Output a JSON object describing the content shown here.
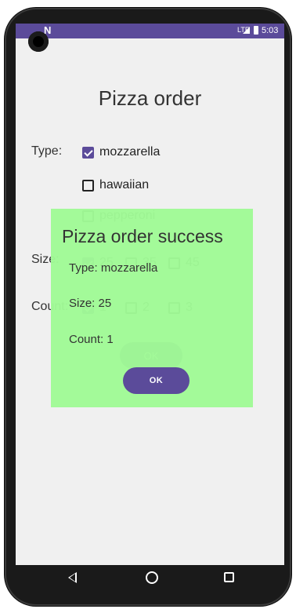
{
  "statusbar": {
    "time": "5:03",
    "network": "LTE"
  },
  "app": {
    "title": "Pizza order"
  },
  "form": {
    "type_label": "Type:",
    "type_options": [
      {
        "label": "mozzarella",
        "checked": true
      },
      {
        "label": "hawaiian",
        "checked": false
      },
      {
        "label": "pepperoni",
        "checked": false
      }
    ],
    "size_label": "Size:",
    "size_options": [
      {
        "label": "25",
        "checked": true
      },
      {
        "label": "35",
        "checked": false
      },
      {
        "label": "45",
        "checked": false
      }
    ],
    "count_label": "Count:",
    "count_options": [
      {
        "label": "1",
        "checked": true
      },
      {
        "label": "2",
        "checked": false
      },
      {
        "label": "3",
        "checked": false
      }
    ],
    "ok_label": "OK"
  },
  "dialog": {
    "title": "Pizza order success",
    "type_line": "Type: mozzarella",
    "size_line": "Size: 25",
    "count_line": "Count: 1",
    "ok_label": "OK"
  },
  "colors": {
    "accent": "#5b4b9a",
    "dialog_bg": "#a0fa96",
    "screen_bg": "#f0f0f0"
  }
}
